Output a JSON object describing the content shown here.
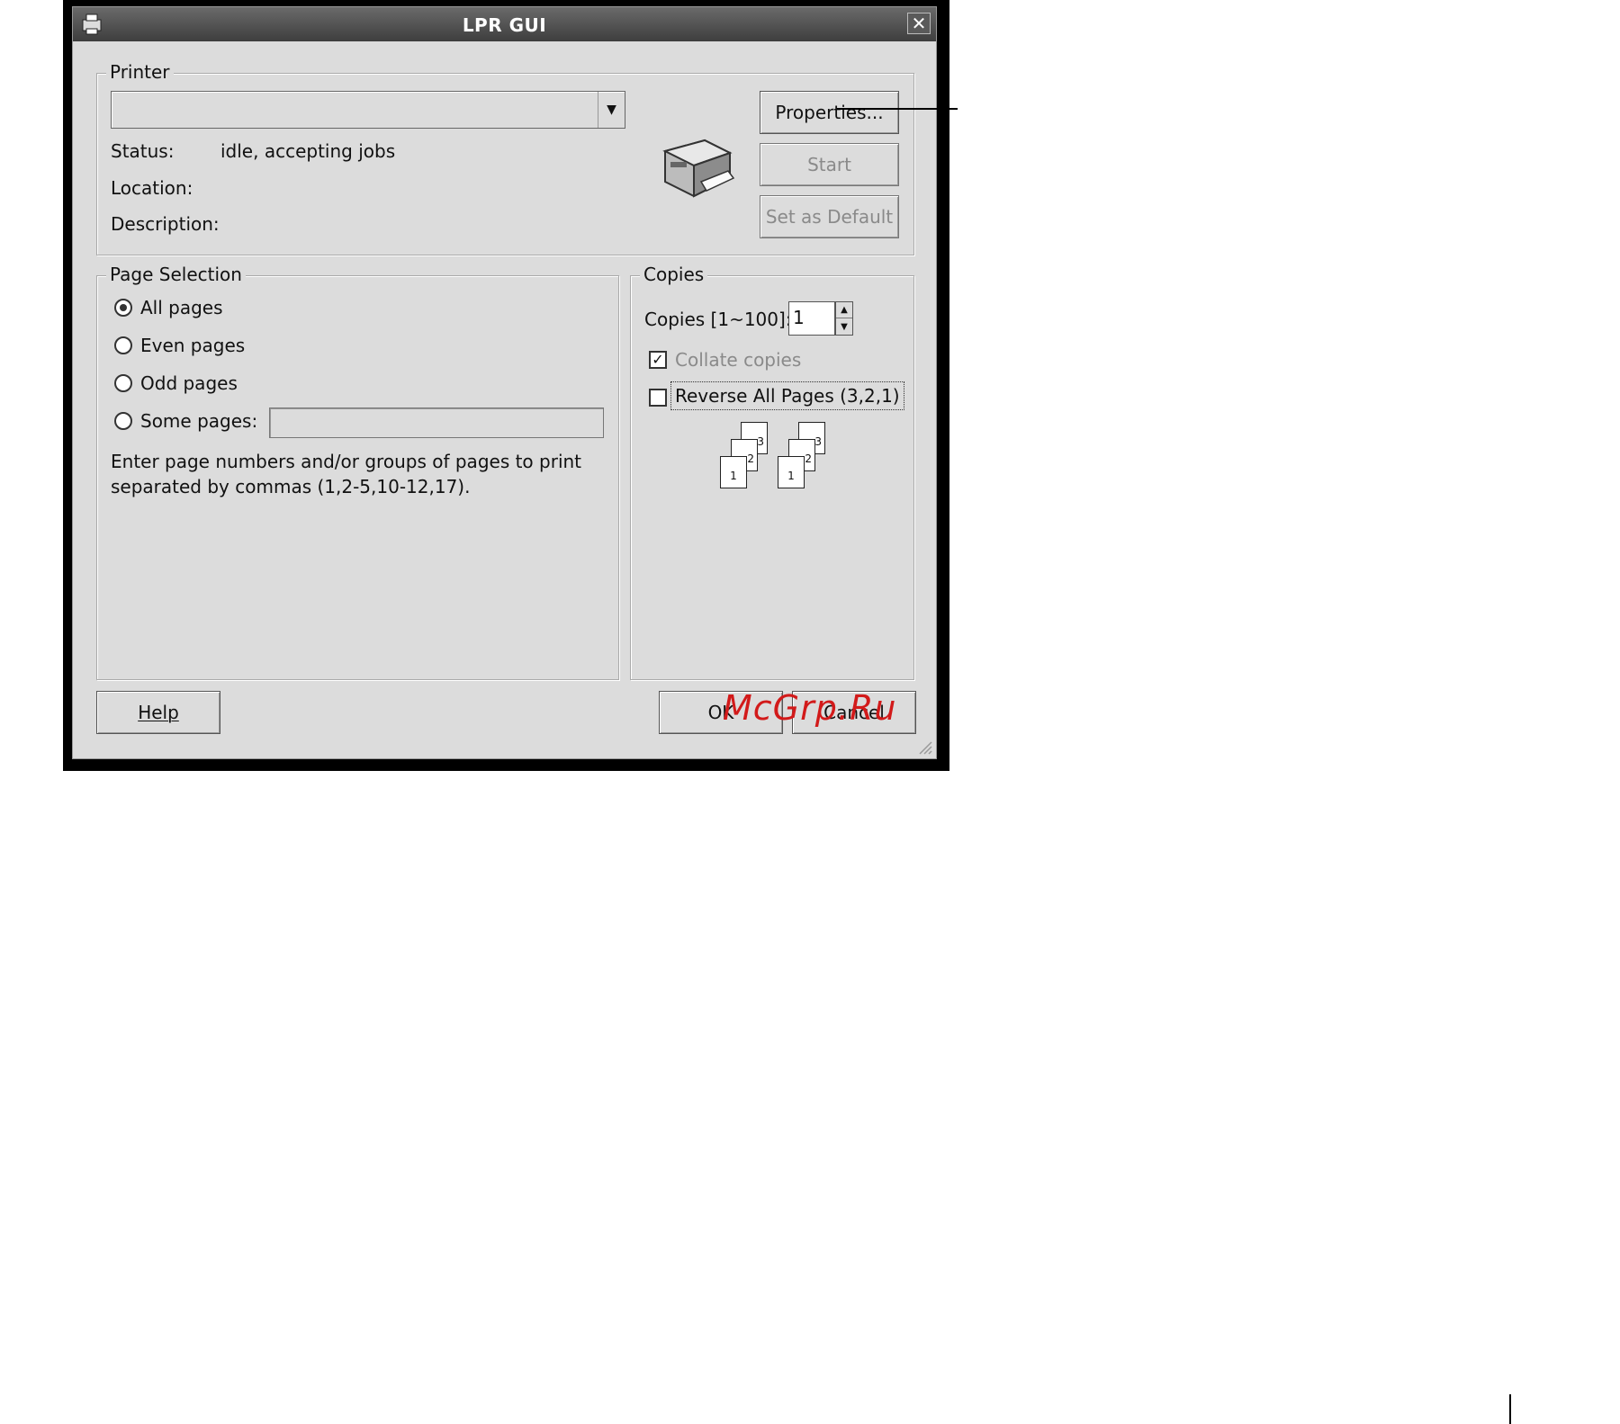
{
  "window": {
    "title": "LPR GUI",
    "close_glyph": "✕"
  },
  "printer": {
    "legend": "Printer",
    "selected": "",
    "status_label": "Status:",
    "status_value": "idle, accepting jobs",
    "location_label": "Location:",
    "location_value": "",
    "description_label": "Description:",
    "description_value": "",
    "properties_button": "Properties...",
    "start_button": "Start",
    "default_button": "Set as Default"
  },
  "page_selection": {
    "legend": "Page Selection",
    "options": [
      "All pages",
      "Even pages",
      "Odd pages",
      "Some pages:"
    ],
    "selected_index": 0,
    "some_pages_value": "",
    "hint": "Enter page numbers and/or groups of pages to print separated by commas (1,2-5,10-12,17).",
    "hint_line1": "Enter page numbers and/or groups of pages to print",
    "hint_line2": "separated by commas (1,2-5,10-12,17)."
  },
  "copies": {
    "legend": "Copies",
    "label": "Copies [1~100]:",
    "value": "1",
    "collate_label": "Collate copies",
    "collate_checked": true,
    "reverse_label": "Reverse All Pages (3,2,1)",
    "reverse_checked": false,
    "page_numbers": [
      "3",
      "2",
      "1"
    ]
  },
  "footer": {
    "help": "Help",
    "ok": "OK",
    "cancel": "Cancel"
  },
  "watermark": "McGrp.Ru"
}
